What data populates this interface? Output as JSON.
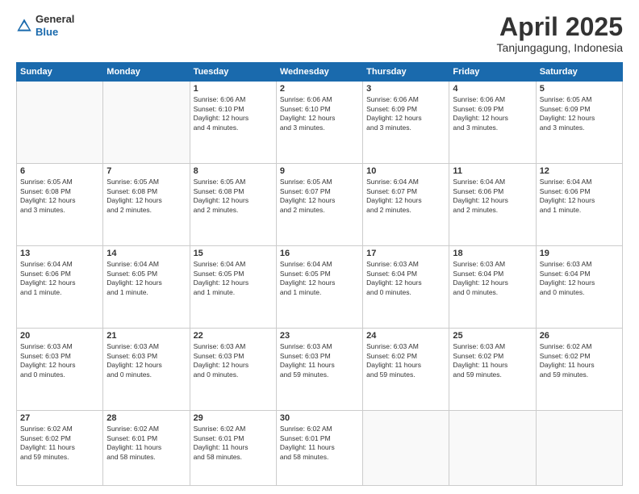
{
  "logo": {
    "general": "General",
    "blue": "Blue"
  },
  "header": {
    "title": "April 2025",
    "subtitle": "Tanjungagung, Indonesia"
  },
  "days_of_week": [
    "Sunday",
    "Monday",
    "Tuesday",
    "Wednesday",
    "Thursday",
    "Friday",
    "Saturday"
  ],
  "weeks": [
    [
      {
        "num": "",
        "info": ""
      },
      {
        "num": "",
        "info": ""
      },
      {
        "num": "1",
        "info": "Sunrise: 6:06 AM\nSunset: 6:10 PM\nDaylight: 12 hours\nand 4 minutes."
      },
      {
        "num": "2",
        "info": "Sunrise: 6:06 AM\nSunset: 6:10 PM\nDaylight: 12 hours\nand 3 minutes."
      },
      {
        "num": "3",
        "info": "Sunrise: 6:06 AM\nSunset: 6:09 PM\nDaylight: 12 hours\nand 3 minutes."
      },
      {
        "num": "4",
        "info": "Sunrise: 6:06 AM\nSunset: 6:09 PM\nDaylight: 12 hours\nand 3 minutes."
      },
      {
        "num": "5",
        "info": "Sunrise: 6:05 AM\nSunset: 6:09 PM\nDaylight: 12 hours\nand 3 minutes."
      }
    ],
    [
      {
        "num": "6",
        "info": "Sunrise: 6:05 AM\nSunset: 6:08 PM\nDaylight: 12 hours\nand 3 minutes."
      },
      {
        "num": "7",
        "info": "Sunrise: 6:05 AM\nSunset: 6:08 PM\nDaylight: 12 hours\nand 2 minutes."
      },
      {
        "num": "8",
        "info": "Sunrise: 6:05 AM\nSunset: 6:08 PM\nDaylight: 12 hours\nand 2 minutes."
      },
      {
        "num": "9",
        "info": "Sunrise: 6:05 AM\nSunset: 6:07 PM\nDaylight: 12 hours\nand 2 minutes."
      },
      {
        "num": "10",
        "info": "Sunrise: 6:04 AM\nSunset: 6:07 PM\nDaylight: 12 hours\nand 2 minutes."
      },
      {
        "num": "11",
        "info": "Sunrise: 6:04 AM\nSunset: 6:06 PM\nDaylight: 12 hours\nand 2 minutes."
      },
      {
        "num": "12",
        "info": "Sunrise: 6:04 AM\nSunset: 6:06 PM\nDaylight: 12 hours\nand 1 minute."
      }
    ],
    [
      {
        "num": "13",
        "info": "Sunrise: 6:04 AM\nSunset: 6:06 PM\nDaylight: 12 hours\nand 1 minute."
      },
      {
        "num": "14",
        "info": "Sunrise: 6:04 AM\nSunset: 6:05 PM\nDaylight: 12 hours\nand 1 minute."
      },
      {
        "num": "15",
        "info": "Sunrise: 6:04 AM\nSunset: 6:05 PM\nDaylight: 12 hours\nand 1 minute."
      },
      {
        "num": "16",
        "info": "Sunrise: 6:04 AM\nSunset: 6:05 PM\nDaylight: 12 hours\nand 1 minute."
      },
      {
        "num": "17",
        "info": "Sunrise: 6:03 AM\nSunset: 6:04 PM\nDaylight: 12 hours\nand 0 minutes."
      },
      {
        "num": "18",
        "info": "Sunrise: 6:03 AM\nSunset: 6:04 PM\nDaylight: 12 hours\nand 0 minutes."
      },
      {
        "num": "19",
        "info": "Sunrise: 6:03 AM\nSunset: 6:04 PM\nDaylight: 12 hours\nand 0 minutes."
      }
    ],
    [
      {
        "num": "20",
        "info": "Sunrise: 6:03 AM\nSunset: 6:03 PM\nDaylight: 12 hours\nand 0 minutes."
      },
      {
        "num": "21",
        "info": "Sunrise: 6:03 AM\nSunset: 6:03 PM\nDaylight: 12 hours\nand 0 minutes."
      },
      {
        "num": "22",
        "info": "Sunrise: 6:03 AM\nSunset: 6:03 PM\nDaylight: 12 hours\nand 0 minutes."
      },
      {
        "num": "23",
        "info": "Sunrise: 6:03 AM\nSunset: 6:03 PM\nDaylight: 11 hours\nand 59 minutes."
      },
      {
        "num": "24",
        "info": "Sunrise: 6:03 AM\nSunset: 6:02 PM\nDaylight: 11 hours\nand 59 minutes."
      },
      {
        "num": "25",
        "info": "Sunrise: 6:03 AM\nSunset: 6:02 PM\nDaylight: 11 hours\nand 59 minutes."
      },
      {
        "num": "26",
        "info": "Sunrise: 6:02 AM\nSunset: 6:02 PM\nDaylight: 11 hours\nand 59 minutes."
      }
    ],
    [
      {
        "num": "27",
        "info": "Sunrise: 6:02 AM\nSunset: 6:02 PM\nDaylight: 11 hours\nand 59 minutes."
      },
      {
        "num": "28",
        "info": "Sunrise: 6:02 AM\nSunset: 6:01 PM\nDaylight: 11 hours\nand 58 minutes."
      },
      {
        "num": "29",
        "info": "Sunrise: 6:02 AM\nSunset: 6:01 PM\nDaylight: 11 hours\nand 58 minutes."
      },
      {
        "num": "30",
        "info": "Sunrise: 6:02 AM\nSunset: 6:01 PM\nDaylight: 11 hours\nand 58 minutes."
      },
      {
        "num": "",
        "info": ""
      },
      {
        "num": "",
        "info": ""
      },
      {
        "num": "",
        "info": ""
      }
    ]
  ]
}
